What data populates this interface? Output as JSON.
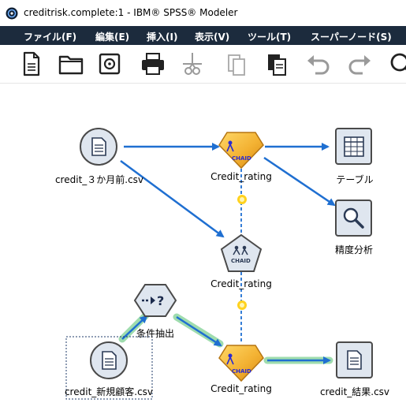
{
  "window": {
    "title": "creditrisk.complete:1 - IBM® SPSS® Modeler",
    "app_icon": "spss-modeler-icon"
  },
  "menubar": {
    "items": [
      {
        "label": "ファイル(F)"
      },
      {
        "label": "編集(E)"
      },
      {
        "label": "挿入(I)"
      },
      {
        "label": "表示(V)"
      },
      {
        "label": "ツール(T)"
      },
      {
        "label": "スーパーノード(S)"
      }
    ]
  },
  "toolbar": {
    "buttons": [
      {
        "icon": "new-file-icon"
      },
      {
        "icon": "open-folder-icon"
      },
      {
        "icon": "save-disk-icon"
      },
      {
        "icon": "print-icon"
      },
      {
        "icon": "cut-icon",
        "enabled": false
      },
      {
        "icon": "copy-icon",
        "enabled": false
      },
      {
        "icon": "paste-icon"
      },
      {
        "icon": "undo-icon",
        "enabled": false
      },
      {
        "icon": "redo-icon",
        "enabled": false
      },
      {
        "icon": "search-icon"
      }
    ]
  },
  "canvas": {
    "colors": {
      "link": "#1f6fd1",
      "link_highlight": "#9fdcae",
      "node_fill": "#dfe6ef",
      "node_border": "#4a4a4a",
      "chaid_gold": "#f3b233",
      "model_link": "#1f6fd1",
      "model_dot": "#ffd21f"
    },
    "nodes": {
      "credit_3months": {
        "label": "credit_３か月前.csv",
        "icon": "file-source-icon"
      },
      "chaid_top": {
        "label": "Credit_rating",
        "icon": "chaid-model-nugget-icon",
        "badge": "CHAID"
      },
      "table": {
        "label": "テーブル",
        "icon": "table-icon"
      },
      "analysis": {
        "label": "精度分析",
        "icon": "magnifier-icon"
      },
      "chaid_modeler": {
        "label": "Credit_rating",
        "icon": "chaid-modeling-icon",
        "badge": "CHAID"
      },
      "select": {
        "label": "条件抽出",
        "icon": "select-condition-icon"
      },
      "credit_new": {
        "label": "credit_新規顧客.csv",
        "icon": "file-source-icon"
      },
      "chaid_bottom": {
        "label": "Credit_rating",
        "icon": "chaid-model-nugget-icon",
        "badge": "CHAID"
      },
      "result": {
        "label": "credit_結果.csv",
        "icon": "file-export-icon"
      }
    }
  }
}
